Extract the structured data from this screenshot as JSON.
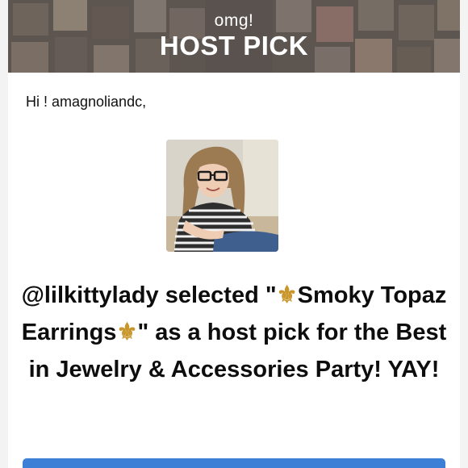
{
  "banner": {
    "small_text": "omg!",
    "title": "HOST PICK"
  },
  "greeting": "Hi ! amagnoliandc,",
  "avatar": {
    "icon": "profile-photo-woman-with-glasses"
  },
  "message": {
    "part1": "@lilkittylady selected \"",
    "fleur1": "⚜",
    "part2": "Smoky Topaz Earrings",
    "fleur2": "⚜",
    "part3": "\" as a host pick for the Best in Jewelry & Accessories Party! YAY!"
  },
  "colors": {
    "accent_button": "#3b7fd6",
    "fleur": "#c8962a"
  }
}
